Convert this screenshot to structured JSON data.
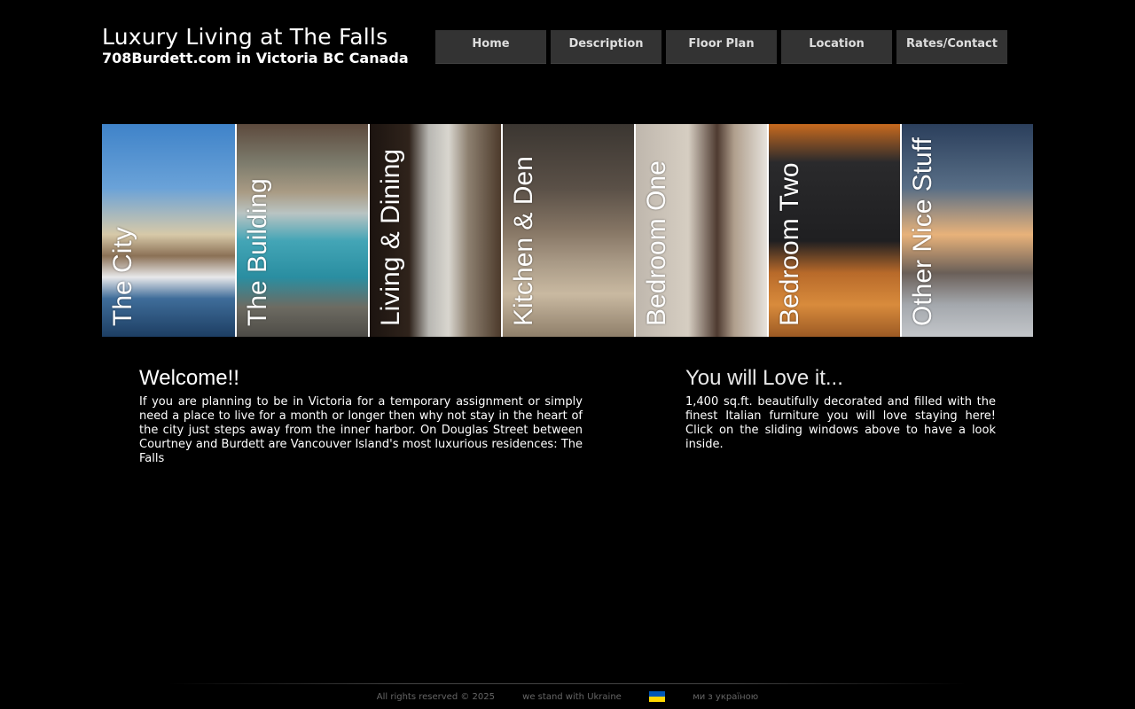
{
  "header": {
    "title": "Luxury Living at The Falls",
    "subtitle": "708Burdett.com in Victoria BC Canada"
  },
  "nav": {
    "items": [
      "Home",
      "Description",
      "Floor Plan",
      "Location",
      "Rates/Contact"
    ]
  },
  "slider": {
    "slides": [
      "The City",
      "The Building",
      "Living & Dining",
      "Kitchen & Den",
      "Bedroom One",
      "Bedroom Two",
      "Other Nice Stuff"
    ]
  },
  "welcome": {
    "heading": "Welcome!!",
    "body": "If you are planning to be in Victoria for a temporary assignment or simply need a place to live for a month or longer then why not stay in the heart of the city just steps away from the inner harbor. On Douglas Street between Courtney and Burdett are Vancouver Island's most luxurious residences: The Falls"
  },
  "love": {
    "heading": "You will Love it...",
    "body": "1,400 sq.ft. beautifully decorated and filled with the finest Italian furniture you will love staying here! Click on the sliding windows above to have a look inside."
  },
  "footer": {
    "copyright": "All rights reserved © 2025",
    "ukraine": "we stand with Ukraine",
    "ukrainian": "ми з україною",
    "flag_colors": [
      "#0057b7",
      "#ffd700"
    ]
  },
  "colors": {
    "background": "#000000",
    "nav_bg": "#333333",
    "nav_text": "#dddddd"
  }
}
